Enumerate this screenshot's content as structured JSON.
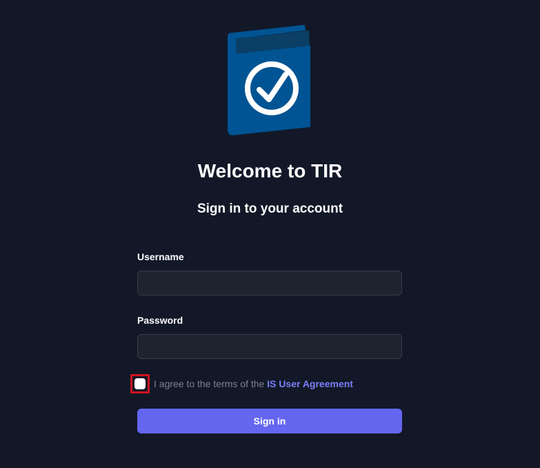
{
  "brand": {
    "logo_icon": "book-checkmark-icon",
    "logo_color": "#005493"
  },
  "header": {
    "title": "Welcome to TIR",
    "subtitle": "Sign in to your account"
  },
  "form": {
    "username_label": "Username",
    "username_value": "",
    "password_label": "Password",
    "password_value": "",
    "agreement_prefix": "I agree to the terms of the",
    "agreement_link": "IS User Agreement",
    "agreement_checked": false,
    "submit_label": "Sign in"
  },
  "colors": {
    "background": "#121827",
    "accent": "#6466f0",
    "link": "#7b7ff7",
    "highlight": "#d1121f"
  }
}
